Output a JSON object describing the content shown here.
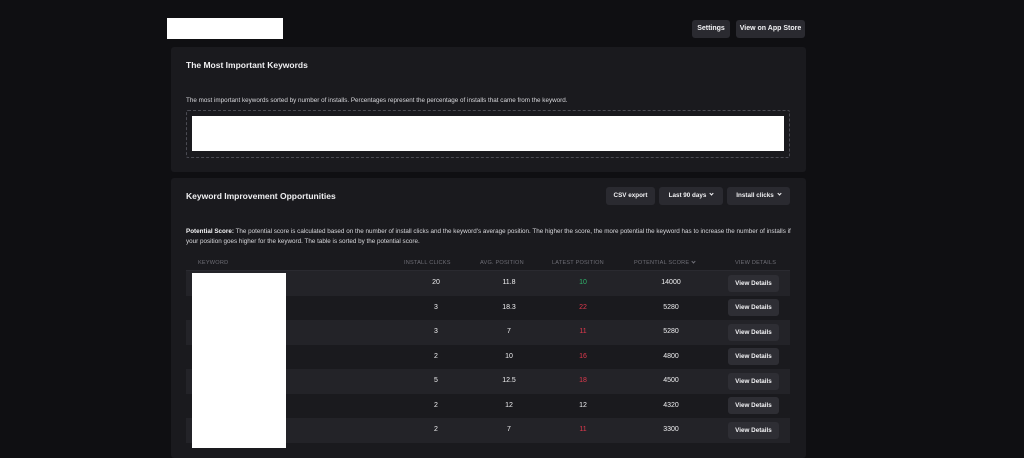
{
  "header": {
    "settings_label": "Settings",
    "app_store_label": "View on App Store"
  },
  "keywords_card": {
    "title": "The Most Important Keywords",
    "description": "The most important keywords sorted by number of installs. Percentages represent the percentage of installs that came from the keyword."
  },
  "opportunities_card": {
    "title": "Keyword Improvement Opportunities",
    "csv_label": "CSV export",
    "range_label": "Last 90 days",
    "metric_label": "Install clicks",
    "potential_score_label": "Potential Score:",
    "potential_score_text": "The potential score is calculated based on the number of install clicks and the keyword's average position. The higher the score, the more potential the keyword has to increase the number of installs if your position goes higher for the keyword. The table is sorted by the potential score.",
    "columns": {
      "keyword": "KEYWORD",
      "install_clicks": "INSTALL CLICKS",
      "avg_position": "AVG. POSITION",
      "latest_position": "LATEST POSITION",
      "potential_score": "POTENTIAL SCORE",
      "view_details": "VIEW DETAILS"
    },
    "rows": [
      {
        "install_clicks": "20",
        "avg_position": "11.8",
        "latest_position": "10",
        "trend": "up",
        "potential_score": "14000",
        "details_label": "View Details"
      },
      {
        "install_clicks": "3",
        "avg_position": "18.3",
        "latest_position": "22",
        "trend": "down",
        "potential_score": "5280",
        "details_label": "View Details"
      },
      {
        "install_clicks": "3",
        "avg_position": "7",
        "latest_position": "11",
        "trend": "down",
        "potential_score": "5280",
        "details_label": "View Details"
      },
      {
        "install_clicks": "2",
        "avg_position": "10",
        "latest_position": "16",
        "trend": "down",
        "potential_score": "4800",
        "details_label": "View Details"
      },
      {
        "install_clicks": "5",
        "avg_position": "12.5",
        "latest_position": "18",
        "trend": "down",
        "potential_score": "4500",
        "details_label": "View Details"
      },
      {
        "install_clicks": "2",
        "avg_position": "12",
        "latest_position": "12",
        "trend": "same",
        "potential_score": "4320",
        "details_label": "View Details"
      },
      {
        "install_clicks": "2",
        "avg_position": "7",
        "latest_position": "11",
        "trend": "down",
        "potential_score": "3300",
        "details_label": "View Details"
      }
    ]
  },
  "colors": {
    "background": "#0f0f12",
    "card": "#1a1a1e",
    "row_alt": "#232328",
    "button": "#2a2a30",
    "positive": "#2fb36a",
    "negative": "#e0384d"
  }
}
